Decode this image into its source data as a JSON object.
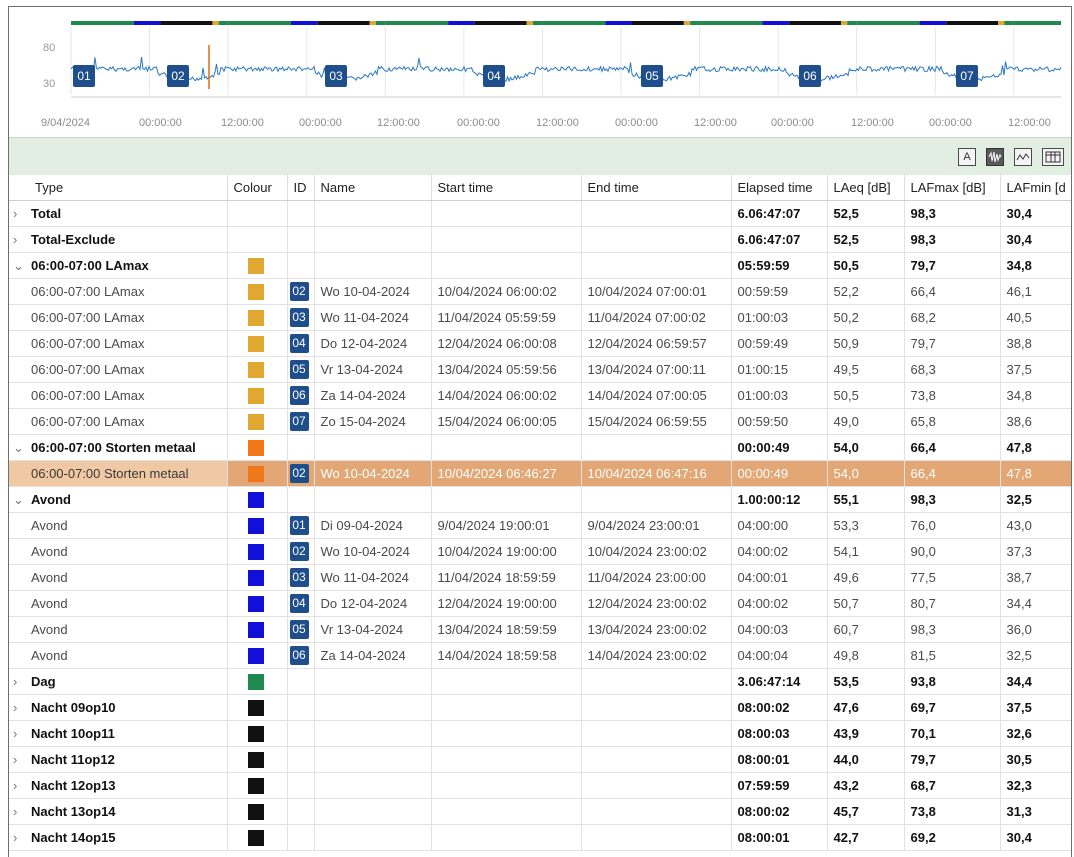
{
  "chart": {
    "y_ticks": [
      "80",
      "30"
    ],
    "x_ticks": [
      "9/04/2024",
      "00:00:00",
      "12:00:00",
      "00:00:00",
      "12:00:00",
      "00:00:00",
      "12:00:00",
      "00:00:00",
      "12:00:00",
      "00:00:00",
      "12:00:00",
      "00:00:00",
      "12:00:00"
    ],
    "markers": [
      "01",
      "02",
      "03",
      "04",
      "05",
      "06",
      "07"
    ],
    "colors": {
      "line": "#2a78c2",
      "day": "#1e8a4e",
      "evening": "#1010d8",
      "night": "#111111",
      "lamax": "#e0a830",
      "event": "#e06a10"
    }
  },
  "toolbar": {
    "buttons": [
      {
        "icon": "text-a-icon",
        "label": "A"
      },
      {
        "icon": "waveform-icon",
        "label": ""
      },
      {
        "icon": "line-chart-icon",
        "label": ""
      },
      {
        "icon": "table-icon",
        "label": ""
      }
    ]
  },
  "table": {
    "headers": [
      "Type",
      "Colour",
      "ID",
      "Name",
      "Start time",
      "End time",
      "Elapsed time",
      "LAeq [dB]",
      "LAFmax [dB]",
      "LAFmin [d"
    ],
    "rows": [
      {
        "kind": "group",
        "expand": "›",
        "type": "Total",
        "colour": "",
        "id": "",
        "name": "",
        "start": "",
        "end": "",
        "elapsed": "6.06:47:07",
        "laeq": "52,5",
        "lafmax": "98,3",
        "lafmin": "30,4"
      },
      {
        "kind": "group",
        "expand": "›",
        "type": "Total-Exclude",
        "colour": "",
        "id": "",
        "name": "",
        "start": "",
        "end": "",
        "elapsed": "6.06:47:07",
        "laeq": "52,5",
        "lafmax": "98,3",
        "lafmin": "30,4"
      },
      {
        "kind": "group",
        "expand": "⌄",
        "type": "06:00-07:00 LAmax",
        "colour": "#e0a830",
        "id": "",
        "name": "",
        "start": "",
        "end": "",
        "elapsed": "05:59:59",
        "laeq": "50,5",
        "lafmax": "79,7",
        "lafmin": "34,8"
      },
      {
        "kind": "child",
        "expand": "",
        "type": "06:00-07:00 LAmax",
        "colour": "#e0a830",
        "id": "02",
        "name": "Wo 10-04-2024",
        "start": "10/04/2024 06:00:02",
        "end": "10/04/2024 07:00:01",
        "elapsed": "00:59:59",
        "laeq": "52,2",
        "lafmax": "66,4",
        "lafmin": "46,1"
      },
      {
        "kind": "child",
        "expand": "",
        "type": "06:00-07:00 LAmax",
        "colour": "#e0a830",
        "id": "03",
        "name": "Wo 11-04-2024",
        "start": "11/04/2024 05:59:59",
        "end": "11/04/2024 07:00:02",
        "elapsed": "01:00:03",
        "laeq": "50,2",
        "lafmax": "68,2",
        "lafmin": "40,5"
      },
      {
        "kind": "child",
        "expand": "",
        "type": "06:00-07:00 LAmax",
        "colour": "#e0a830",
        "id": "04",
        "name": "Do 12-04-2024",
        "start": "12/04/2024 06:00:08",
        "end": "12/04/2024 06:59:57",
        "elapsed": "00:59:49",
        "laeq": "50,9",
        "lafmax": "79,7",
        "lafmin": "38,8"
      },
      {
        "kind": "child",
        "expand": "",
        "type": "06:00-07:00 LAmax",
        "colour": "#e0a830",
        "id": "05",
        "name": "Vr 13-04-2024",
        "start": "13/04/2024 05:59:56",
        "end": "13/04/2024 07:00:11",
        "elapsed": "01:00:15",
        "laeq": "49,5",
        "lafmax": "68,3",
        "lafmin": "37,5"
      },
      {
        "kind": "child",
        "expand": "",
        "type": "06:00-07:00 LAmax",
        "colour": "#e0a830",
        "id": "06",
        "name": "Za 14-04-2024",
        "start": "14/04/2024 06:00:02",
        "end": "14/04/2024 07:00:05",
        "elapsed": "01:00:03",
        "laeq": "50,5",
        "lafmax": "73,8",
        "lafmin": "34,8"
      },
      {
        "kind": "child",
        "expand": "",
        "type": "06:00-07:00 LAmax",
        "colour": "#e0a830",
        "id": "07",
        "name": "Zo 15-04-2024",
        "start": "15/04/2024 06:00:05",
        "end": "15/04/2024 06:59:55",
        "elapsed": "00:59:50",
        "laeq": "49,0",
        "lafmax": "65,8",
        "lafmin": "38,6"
      },
      {
        "kind": "group",
        "expand": "⌄",
        "type": "06:00-07:00 Storten metaal",
        "colour": "#f07818",
        "id": "",
        "name": "",
        "start": "",
        "end": "",
        "elapsed": "00:00:49",
        "laeq": "54,0",
        "lafmax": "66,4",
        "lafmin": "47,8"
      },
      {
        "kind": "selected",
        "expand": "",
        "type": "06:00-07:00 Storten metaal",
        "colour": "#f07818",
        "id": "02",
        "name": "Wo 10-04-2024",
        "start": "10/04/2024 06:46:27",
        "end": "10/04/2024 06:47:16",
        "elapsed": "00:00:49",
        "laeq": "54,0",
        "lafmax": "66,4",
        "lafmin": "47,8"
      },
      {
        "kind": "group",
        "expand": "⌄",
        "type": "Avond",
        "colour": "#1010d8",
        "id": "",
        "name": "",
        "start": "",
        "end": "",
        "elapsed": "1.00:00:12",
        "laeq": "55,1",
        "lafmax": "98,3",
        "lafmin": "32,5"
      },
      {
        "kind": "child",
        "expand": "",
        "type": "Avond",
        "colour": "#1010d8",
        "id": "01",
        "name": "Di 09-04-2024",
        "start": "9/04/2024 19:00:01",
        "end": "9/04/2024 23:00:01",
        "elapsed": "04:00:00",
        "laeq": "53,3",
        "lafmax": "76,0",
        "lafmin": "43,0"
      },
      {
        "kind": "child",
        "expand": "",
        "type": "Avond",
        "colour": "#1010d8",
        "id": "02",
        "name": "Wo 10-04-2024",
        "start": "10/04/2024 19:00:00",
        "end": "10/04/2024 23:00:02",
        "elapsed": "04:00:02",
        "laeq": "54,1",
        "lafmax": "90,0",
        "lafmin": "37,3"
      },
      {
        "kind": "child",
        "expand": "",
        "type": "Avond",
        "colour": "#1010d8",
        "id": "03",
        "name": "Wo 11-04-2024",
        "start": "11/04/2024 18:59:59",
        "end": "11/04/2024 23:00:00",
        "elapsed": "04:00:01",
        "laeq": "49,6",
        "lafmax": "77,5",
        "lafmin": "38,7"
      },
      {
        "kind": "child",
        "expand": "",
        "type": "Avond",
        "colour": "#1010d8",
        "id": "04",
        "name": "Do 12-04-2024",
        "start": "12/04/2024 19:00:00",
        "end": "12/04/2024 23:00:02",
        "elapsed": "04:00:02",
        "laeq": "50,7",
        "lafmax": "80,7",
        "lafmin": "34,4"
      },
      {
        "kind": "child",
        "expand": "",
        "type": "Avond",
        "colour": "#1010d8",
        "id": "05",
        "name": "Vr 13-04-2024",
        "start": "13/04/2024 18:59:59",
        "end": "13/04/2024 23:00:02",
        "elapsed": "04:00:03",
        "laeq": "60,7",
        "lafmax": "98,3",
        "lafmin": "36,0"
      },
      {
        "kind": "child",
        "expand": "",
        "type": "Avond",
        "colour": "#1010d8",
        "id": "06",
        "name": "Za 14-04-2024",
        "start": "14/04/2024 18:59:58",
        "end": "14/04/2024 23:00:02",
        "elapsed": "04:00:04",
        "laeq": "49,8",
        "lafmax": "81,5",
        "lafmin": "32,5"
      },
      {
        "kind": "group",
        "expand": "›",
        "type": "Dag",
        "colour": "#1e8a4e",
        "id": "",
        "name": "",
        "start": "",
        "end": "",
        "elapsed": "3.06:47:14",
        "laeq": "53,5",
        "lafmax": "93,8",
        "lafmin": "34,4"
      },
      {
        "kind": "group",
        "expand": "›",
        "type": "Nacht 09op10",
        "colour": "#111111",
        "id": "",
        "name": "",
        "start": "",
        "end": "",
        "elapsed": "08:00:02",
        "laeq": "47,6",
        "lafmax": "69,7",
        "lafmin": "37,5"
      },
      {
        "kind": "group",
        "expand": "›",
        "type": "Nacht 10op11",
        "colour": "#111111",
        "id": "",
        "name": "",
        "start": "",
        "end": "",
        "elapsed": "08:00:03",
        "laeq": "43,9",
        "lafmax": "70,1",
        "lafmin": "32,6"
      },
      {
        "kind": "group",
        "expand": "›",
        "type": "Nacht 11op12",
        "colour": "#111111",
        "id": "",
        "name": "",
        "start": "",
        "end": "",
        "elapsed": "08:00:01",
        "laeq": "44,0",
        "lafmax": "79,7",
        "lafmin": "30,5"
      },
      {
        "kind": "group",
        "expand": "›",
        "type": "Nacht 12op13",
        "colour": "#111111",
        "id": "",
        "name": "",
        "start": "",
        "end": "",
        "elapsed": "07:59:59",
        "laeq": "43,2",
        "lafmax": "68,7",
        "lafmin": "32,3"
      },
      {
        "kind": "group",
        "expand": "›",
        "type": "Nacht 13op14",
        "colour": "#111111",
        "id": "",
        "name": "",
        "start": "",
        "end": "",
        "elapsed": "08:00:02",
        "laeq": "45,7",
        "lafmax": "73,8",
        "lafmin": "31,3"
      },
      {
        "kind": "group",
        "expand": "›",
        "type": "Nacht 14op15",
        "colour": "#111111",
        "id": "",
        "name": "",
        "start": "",
        "end": "",
        "elapsed": "08:00:01",
        "laeq": "42,7",
        "lafmax": "69,2",
        "lafmin": "30,4"
      }
    ]
  }
}
